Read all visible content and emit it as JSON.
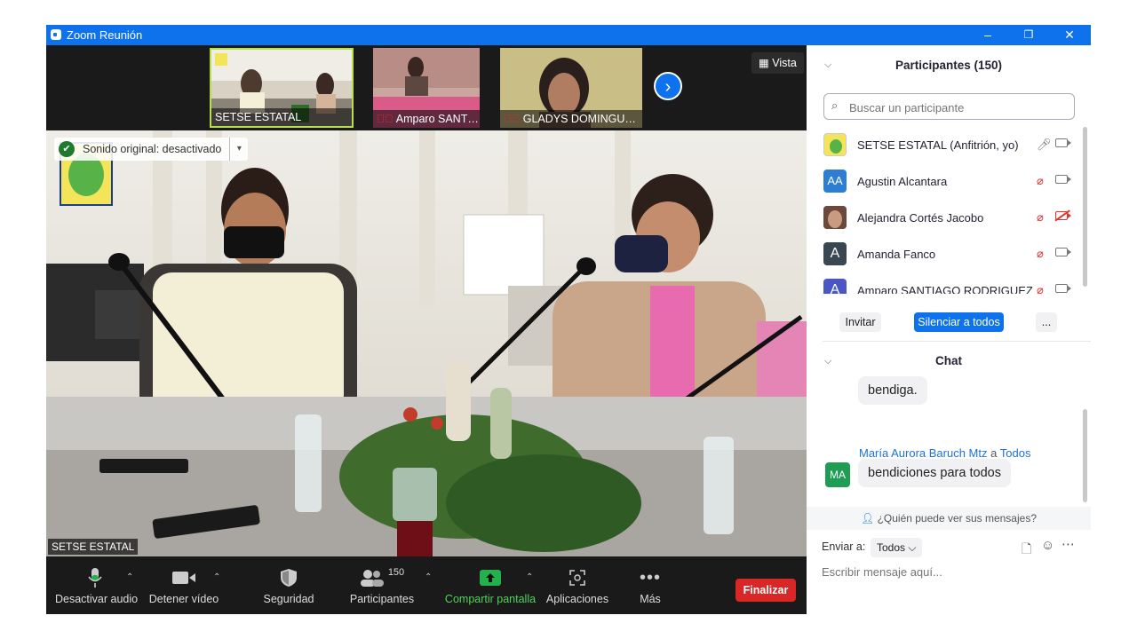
{
  "window": {
    "title": "Zoom Reunión",
    "minimize": "–",
    "restore": "❐",
    "close": "✕"
  },
  "thumbnails": [
    {
      "name": "SETSE ESTATAL",
      "muted": false
    },
    {
      "name": "Amparo SANTIAGO R...",
      "muted": true
    },
    {
      "name": "GLADYS DOMINGUEZ...",
      "muted": true
    }
  ],
  "view_button": "Vista",
  "sound_banner": "Sonido original: desactivado",
  "active_speaker": "SETSE ESTATAL",
  "toolbar": {
    "mute": "Desactivar audio",
    "video": "Detener vídeo",
    "security": "Seguridad",
    "participants": "Participantes",
    "participants_count": "150",
    "share": "Compartir pantalla",
    "apps": "Aplicaciones",
    "more": "Más",
    "end": "Finalizar"
  },
  "participants_panel": {
    "title": "Participantes (150)",
    "search_placeholder": "Buscar un participante",
    "items": [
      {
        "name": "SETSE ESTATAL (Anfitrión, yo)",
        "initials": "",
        "avatar_color": "#f3e45a",
        "mic": "on",
        "camera": "on"
      },
      {
        "name": "Agustin Alcantara",
        "initials": "AA",
        "avatar_color": "#2d7dd2",
        "mic": "muted",
        "camera": "on"
      },
      {
        "name": "Alejandra Cortés Jacobo",
        "initials": "",
        "avatar_color": "#9b6b54",
        "mic": "muted",
        "camera": "off"
      },
      {
        "name": "Amanda Fanco",
        "initials": "A",
        "avatar_color": "#3a4652",
        "mic": "muted",
        "camera": "on"
      },
      {
        "name": "Amparo SANTIAGO RODRIGUEZ",
        "initials": "A",
        "avatar_color": "#4a56c4",
        "mic": "muted",
        "camera": "on"
      }
    ],
    "invite": "Invitar",
    "mute_all": "Silenciar a todos",
    "more": "..."
  },
  "chat_panel": {
    "title": "Chat",
    "messages": [
      {
        "text": "bendiga."
      },
      {
        "sender": "María Aurora Baruch Mtz",
        "connector": "a",
        "recipient": "Todos",
        "initials": "MA",
        "avatar_color": "#1f9d55",
        "text": "bendiciones para todos"
      }
    ],
    "who_sees": "¿Quién puede ver sus mensajes?",
    "send_to_label": "Enviar a:",
    "send_to_value": "Todos",
    "input_placeholder": "Escribir mensaje aquí..."
  }
}
